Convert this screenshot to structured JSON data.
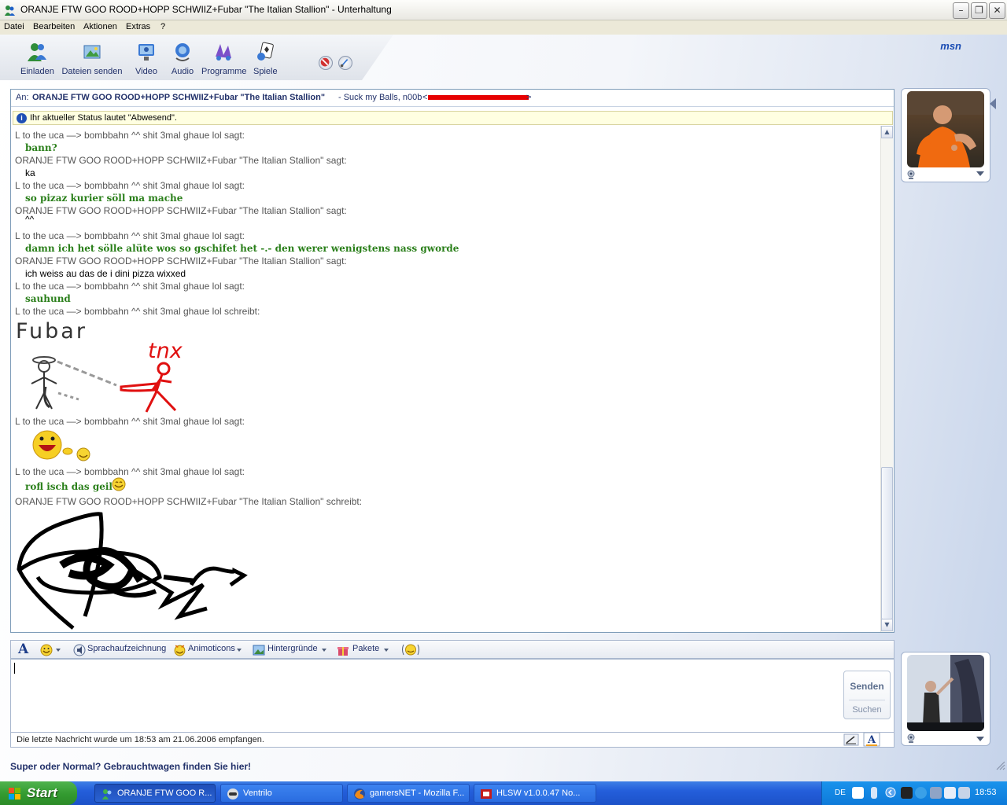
{
  "window": {
    "title": "ORANJE FTW GOO ROOD+HOPP SCHWIIZ+Fubar  \"The Italian Stallion\" - Unterhaltung",
    "min_symbol": "–",
    "max_symbol": "❐",
    "close_symbol": "✕"
  },
  "menu": [
    "Datei",
    "Bearbeiten",
    "Aktionen",
    "Extras",
    "?"
  ],
  "toolbar": {
    "buttons": [
      "Einladen",
      "Dateien senden",
      "Video",
      "Audio",
      "Programme",
      "Spiele"
    ],
    "logo": "msn"
  },
  "conversation": {
    "to_label": "An:",
    "to_name": "ORANJE FTW GOO ROOD+HOPP SCHWIIZ+Fubar  \"The Italian Stallion\"",
    "to_message": "- Suck my Balls, n00b",
    "to_lt": "<",
    "to_gt": ">",
    "status_icon": "i",
    "status_text": "Ihr aktueller Status lautet \"Abwesend\".",
    "lines": [
      {
        "type": "sender",
        "text": "L to the uca   —> bombbahn ^^ shit 3mal ghaue lol sagt:"
      },
      {
        "type": "green",
        "text": "bann?"
      },
      {
        "type": "sender",
        "text": "ORANJE FTW GOO ROOD+HOPP SCHWIIZ+Fubar  \"The Italian Stallion\" sagt:"
      },
      {
        "type": "black",
        "text": "ka"
      },
      {
        "type": "sender",
        "text": "L to the uca   —> bombbahn ^^ shit 3mal ghaue lol sagt:"
      },
      {
        "type": "green",
        "text": "so pizaz kurier söll ma mache"
      },
      {
        "type": "sender",
        "text": "ORANJE FTW GOO ROOD+HOPP SCHWIIZ+Fubar  \"The Italian Stallion\" sagt:"
      },
      {
        "type": "black",
        "text": "^^"
      },
      {
        "type": "sender",
        "text": "L to the uca   —> bombbahn ^^ shit 3mal ghaue lol sagt:"
      },
      {
        "type": "green",
        "text": "damn ich het sölle alüte wos so gschifet het -.- den werer wenigstens nass gworde"
      },
      {
        "type": "sender",
        "text": "ORANJE FTW GOO ROOD+HOPP SCHWIIZ+Fubar  \"The Italian Stallion\" sagt:"
      },
      {
        "type": "black",
        "text": "ich weiss au das de i dini pizza wixxed"
      },
      {
        "type": "sender",
        "text": "L to the uca   —> bombbahn ^^ shit 3mal ghaue lol sagt:"
      },
      {
        "type": "green",
        "text": "sauhund"
      },
      {
        "type": "sender",
        "text": "L to the uca   —> bombbahn ^^ shit 3mal ghaue lol schreibt:"
      }
    ],
    "ink_label_fubar": "Fubar",
    "ink_label_tnx": "tnx",
    "after_ink_sender": "L to the uca   —> bombbahn ^^ shit 3mal ghaue lol sagt:",
    "sender_rofl": "L to the uca   —> bombbahn ^^ shit 3mal ghaue lol sagt:",
    "rofl_text": "rofl isch das geil",
    "sender_last": "ORANJE FTW GOO ROOD+HOPP SCHWIIZ+Fubar  \"The Italian Stallion\" schreibt:"
  },
  "input_toolbar": {
    "font_glyph": "A",
    "voice": "Sprachaufzeichnung",
    "animoticons": "Animoticons",
    "backgrounds": "Hintergründe",
    "packages": "Pakete"
  },
  "send": {
    "send_label": "Senden",
    "search_label": "Suchen"
  },
  "last_message": "Die letzte Nachricht wurde um 18:53 am 21.06.2006 empfangen.",
  "ad_text": "Super oder Normal? Gebrauchtwagen finden Sie hier!",
  "taskbar": {
    "start": "Start",
    "tasks": [
      "ORANJE FTW GOO R...",
      "Ventrilo",
      "gamersNET - Mozilla F...",
      "HLSW v1.0.0.47    No..."
    ],
    "lang": "DE",
    "time": "18:53"
  },
  "colors": {
    "accent": "#22316a",
    "green_text": "#2a7f1a",
    "redaction": "#e60000"
  }
}
